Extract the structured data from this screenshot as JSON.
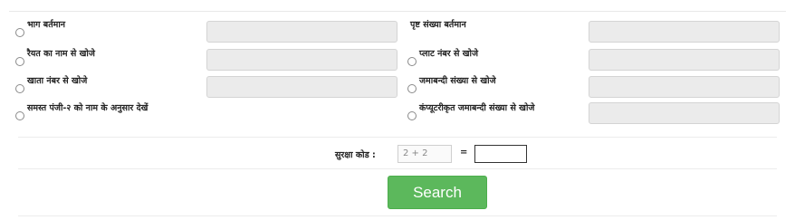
{
  "options": {
    "opt1": {
      "label": "भाग बर्तमान"
    },
    "opt2": {
      "label": "पृष्ट संख्या बर्तमान"
    },
    "opt3": {
      "label": "रैयत का नाम से खोजे"
    },
    "opt4": {
      "label": "प्लाट नंबर से खोजे"
    },
    "opt5": {
      "label": "खाता नंबर से खोजे"
    },
    "opt6": {
      "label": "जमाबन्दी संख्या से खोजे"
    },
    "opt7": {
      "label": "समस्त पंजी-२ को नाम के अनुसार देखें"
    },
    "opt8": {
      "label": "कंप्यूटरीकृत जमाबन्दी संख्या से खोजे"
    }
  },
  "captcha": {
    "label": "सुरक्षा कोड :",
    "question": "2 + 2",
    "equals": "=",
    "answer": ""
  },
  "search_button": {
    "label": "Search"
  }
}
